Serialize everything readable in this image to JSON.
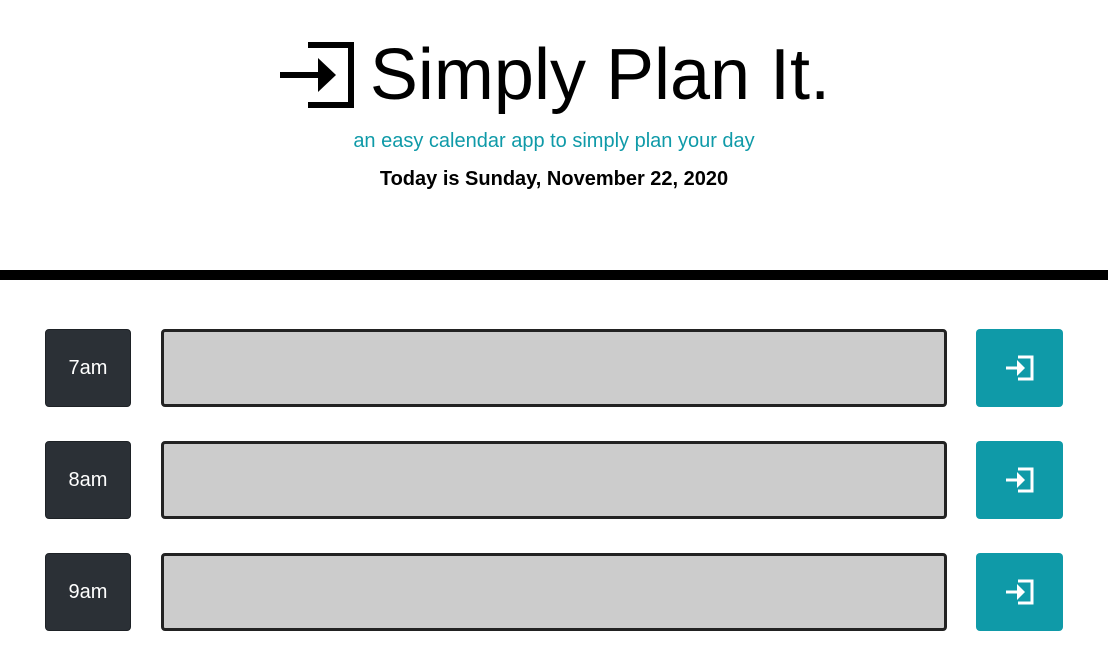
{
  "header": {
    "title": "Simply Plan It.",
    "subtitle": "an easy calendar app to simply plan your day",
    "today": "Today is Sunday, November 22, 2020",
    "logo_icon": "sign-in-icon"
  },
  "rows": [
    {
      "hour": "7am",
      "event_value": "",
      "save_icon": "sign-in-icon"
    },
    {
      "hour": "8am",
      "event_value": "",
      "save_icon": "sign-in-icon"
    },
    {
      "hour": "9am",
      "event_value": "",
      "save_icon": "sign-in-icon"
    }
  ],
  "colors": {
    "accent": "#0f9aa8",
    "hour_block": "#2b3036",
    "event_bg": "#cccccc",
    "divider": "#000000"
  }
}
